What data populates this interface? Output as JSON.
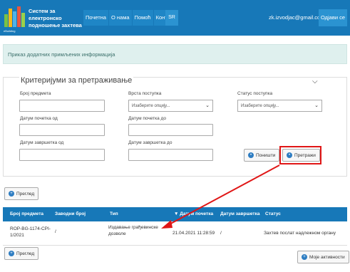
{
  "header": {
    "brand_line1": "Систем за електронско",
    "brand_line2": "подношење захтева",
    "logo_text": "eBuilding",
    "nav": [
      "Почетна",
      "О нама",
      "Помоћ",
      "Контакт"
    ],
    "lang": "SR",
    "email": "zk.izvodjac@gmail.com",
    "logout": "Одјави се"
  },
  "info": {
    "text": "Приказ додатних примљених информација"
  },
  "criteria": {
    "title": "Критеријуми за претраживање",
    "fields": {
      "case_number": "Број предмета",
      "procedure_type": "Врста поступка",
      "procedure_status": "Статус поступка",
      "start_date_from": "Датум почетка од",
      "start_date_to": "Датум почетка до",
      "end_date_from": "Датум завршетка од",
      "end_date_to": "Датум завршетка до"
    },
    "select_placeholder": "Изаберите опцију...",
    "cancel": "Поништи",
    "search": "Претражи"
  },
  "overview_label": "Преглед",
  "table": {
    "headers": [
      "Број предмета",
      "Заводни број",
      "Тип",
      "▼ Датум почетка",
      "Датум завршетка",
      "Статус"
    ],
    "rows": [
      {
        "case_line1": "ROP-BG-1174-CPI-",
        "case_line2": "1/2021",
        "reg_no": "/",
        "type_line1": "Издавање грађевинске",
        "type_line2": "дозволе",
        "start": "21.04.2021 11:28:59",
        "end": "/",
        "status": "Захтев послат надлежном органу"
      }
    ]
  },
  "my_activities": "Моје активности",
  "colors": {
    "header": "#1778b8",
    "highlight": "#e01616"
  }
}
